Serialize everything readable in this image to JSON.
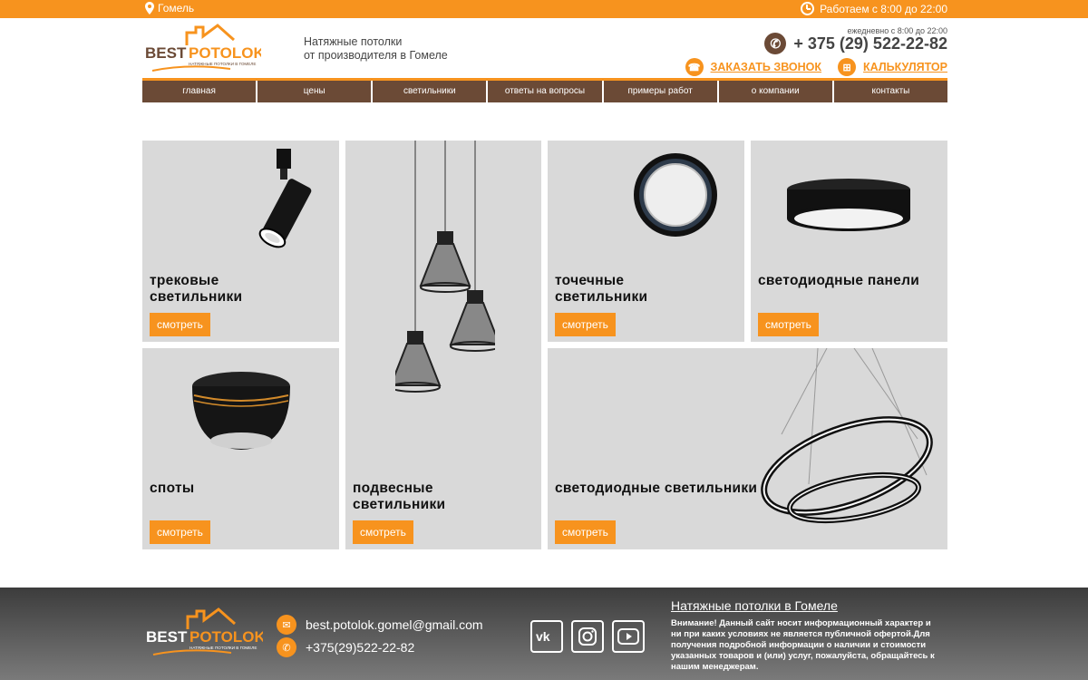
{
  "colors": {
    "accent": "#f7931e",
    "brown": "#6b4a36",
    "tile_bg": "#d9d9d9"
  },
  "topbar": {
    "city": "Гомель",
    "city_icon": "map-pin-icon",
    "hours": "Работаем с 8:00 до 22:00",
    "hours_icon": "clock-icon"
  },
  "header": {
    "logo_main_left": "BEST",
    "logo_main_right": "POTOLOK",
    "logo_sub": "НАТЯЖНЫЕ ПОТОЛКИ В ГОМЕЛЕ",
    "tagline_line1": "Натяжные потолки",
    "tagline_line2": "от производителя в Гомеле",
    "schedule_note": "ежедневно с 8:00 до 22:00",
    "phone": "+ 375 (29) 522-22-82",
    "callback_label": "ЗАКАЗАТЬ ЗВОНОК",
    "calculator_label": "КАЛЬКУЛЯТОР"
  },
  "nav": {
    "items": [
      "главная",
      "цены",
      "светильники",
      "ответы на вопросы",
      "примеры работ",
      "о компании",
      "контакты"
    ]
  },
  "tiles": [
    {
      "title_line1": "трековые",
      "title_line2": "светильники",
      "button": "смотреть"
    },
    {
      "title_line1": "подвесные",
      "title_line2": "светильники",
      "button": "смотреть"
    },
    {
      "title_line1": "точечные",
      "title_line2": "светильники",
      "button": "смотреть"
    },
    {
      "title_line1": "",
      "title_line2": "светодиодные панели",
      "button": "смотреть"
    },
    {
      "title_line1": "",
      "title_line2": "споты",
      "button": "смотреть"
    },
    {
      "title_line1": "",
      "title_line2": "светодиодные светильники",
      "button": "смотреть"
    }
  ],
  "footer": {
    "email": "best.potolok.gomel@gmail.com",
    "phone": "+375(29)522-22-82",
    "socials": [
      "vk-icon",
      "instagram-icon",
      "youtube-icon"
    ],
    "title": "Натяжные потолки в Гомеле",
    "text": "Внимание! Данный сайт носит информационный характер и ни при каких условиях не является публичной офертой.Для получения подробной информации о наличии и стоимости указанных товаров и (или) услуг, пожалуйста, обращайтесь к нашим менеджерам."
  }
}
